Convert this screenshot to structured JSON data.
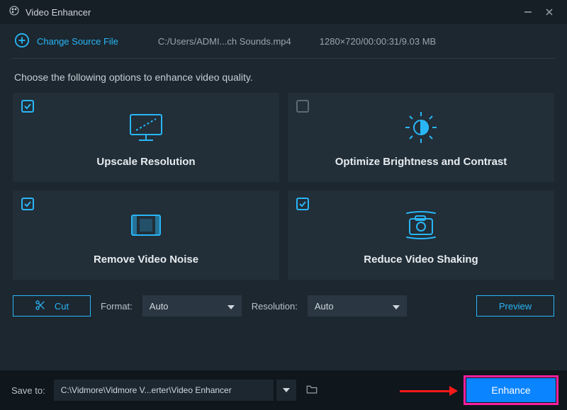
{
  "titlebar": {
    "title": "Video Enhancer"
  },
  "source": {
    "change_label": "Change Source File",
    "file_path": "C:/Users/ADMI...ch Sounds.mp4",
    "file_meta": "1280×720/00:00:31/9.03 MB"
  },
  "instruction": "Choose the following options to enhance video quality.",
  "options": [
    {
      "label": "Upscale Resolution",
      "checked": true,
      "icon": "monitor-upscale-icon"
    },
    {
      "label": "Optimize Brightness and Contrast",
      "checked": false,
      "icon": "brightness-icon"
    },
    {
      "label": "Remove Video Noise",
      "checked": true,
      "icon": "film-noise-icon"
    },
    {
      "label": "Reduce Video Shaking",
      "checked": true,
      "icon": "camera-shake-icon"
    }
  ],
  "controls": {
    "cut_label": "Cut",
    "format_label": "Format:",
    "format_value": "Auto",
    "resolution_label": "Resolution:",
    "resolution_value": "Auto",
    "preview_label": "Preview"
  },
  "bottom": {
    "save_to_label": "Save to:",
    "save_path": "C:\\Vidmore\\Vidmore V...erter\\Video Enhancer",
    "enhance_label": "Enhance"
  },
  "colors": {
    "accent": "#29b6f6",
    "primary": "#0a84ff",
    "highlight": "#ff1fa0"
  }
}
